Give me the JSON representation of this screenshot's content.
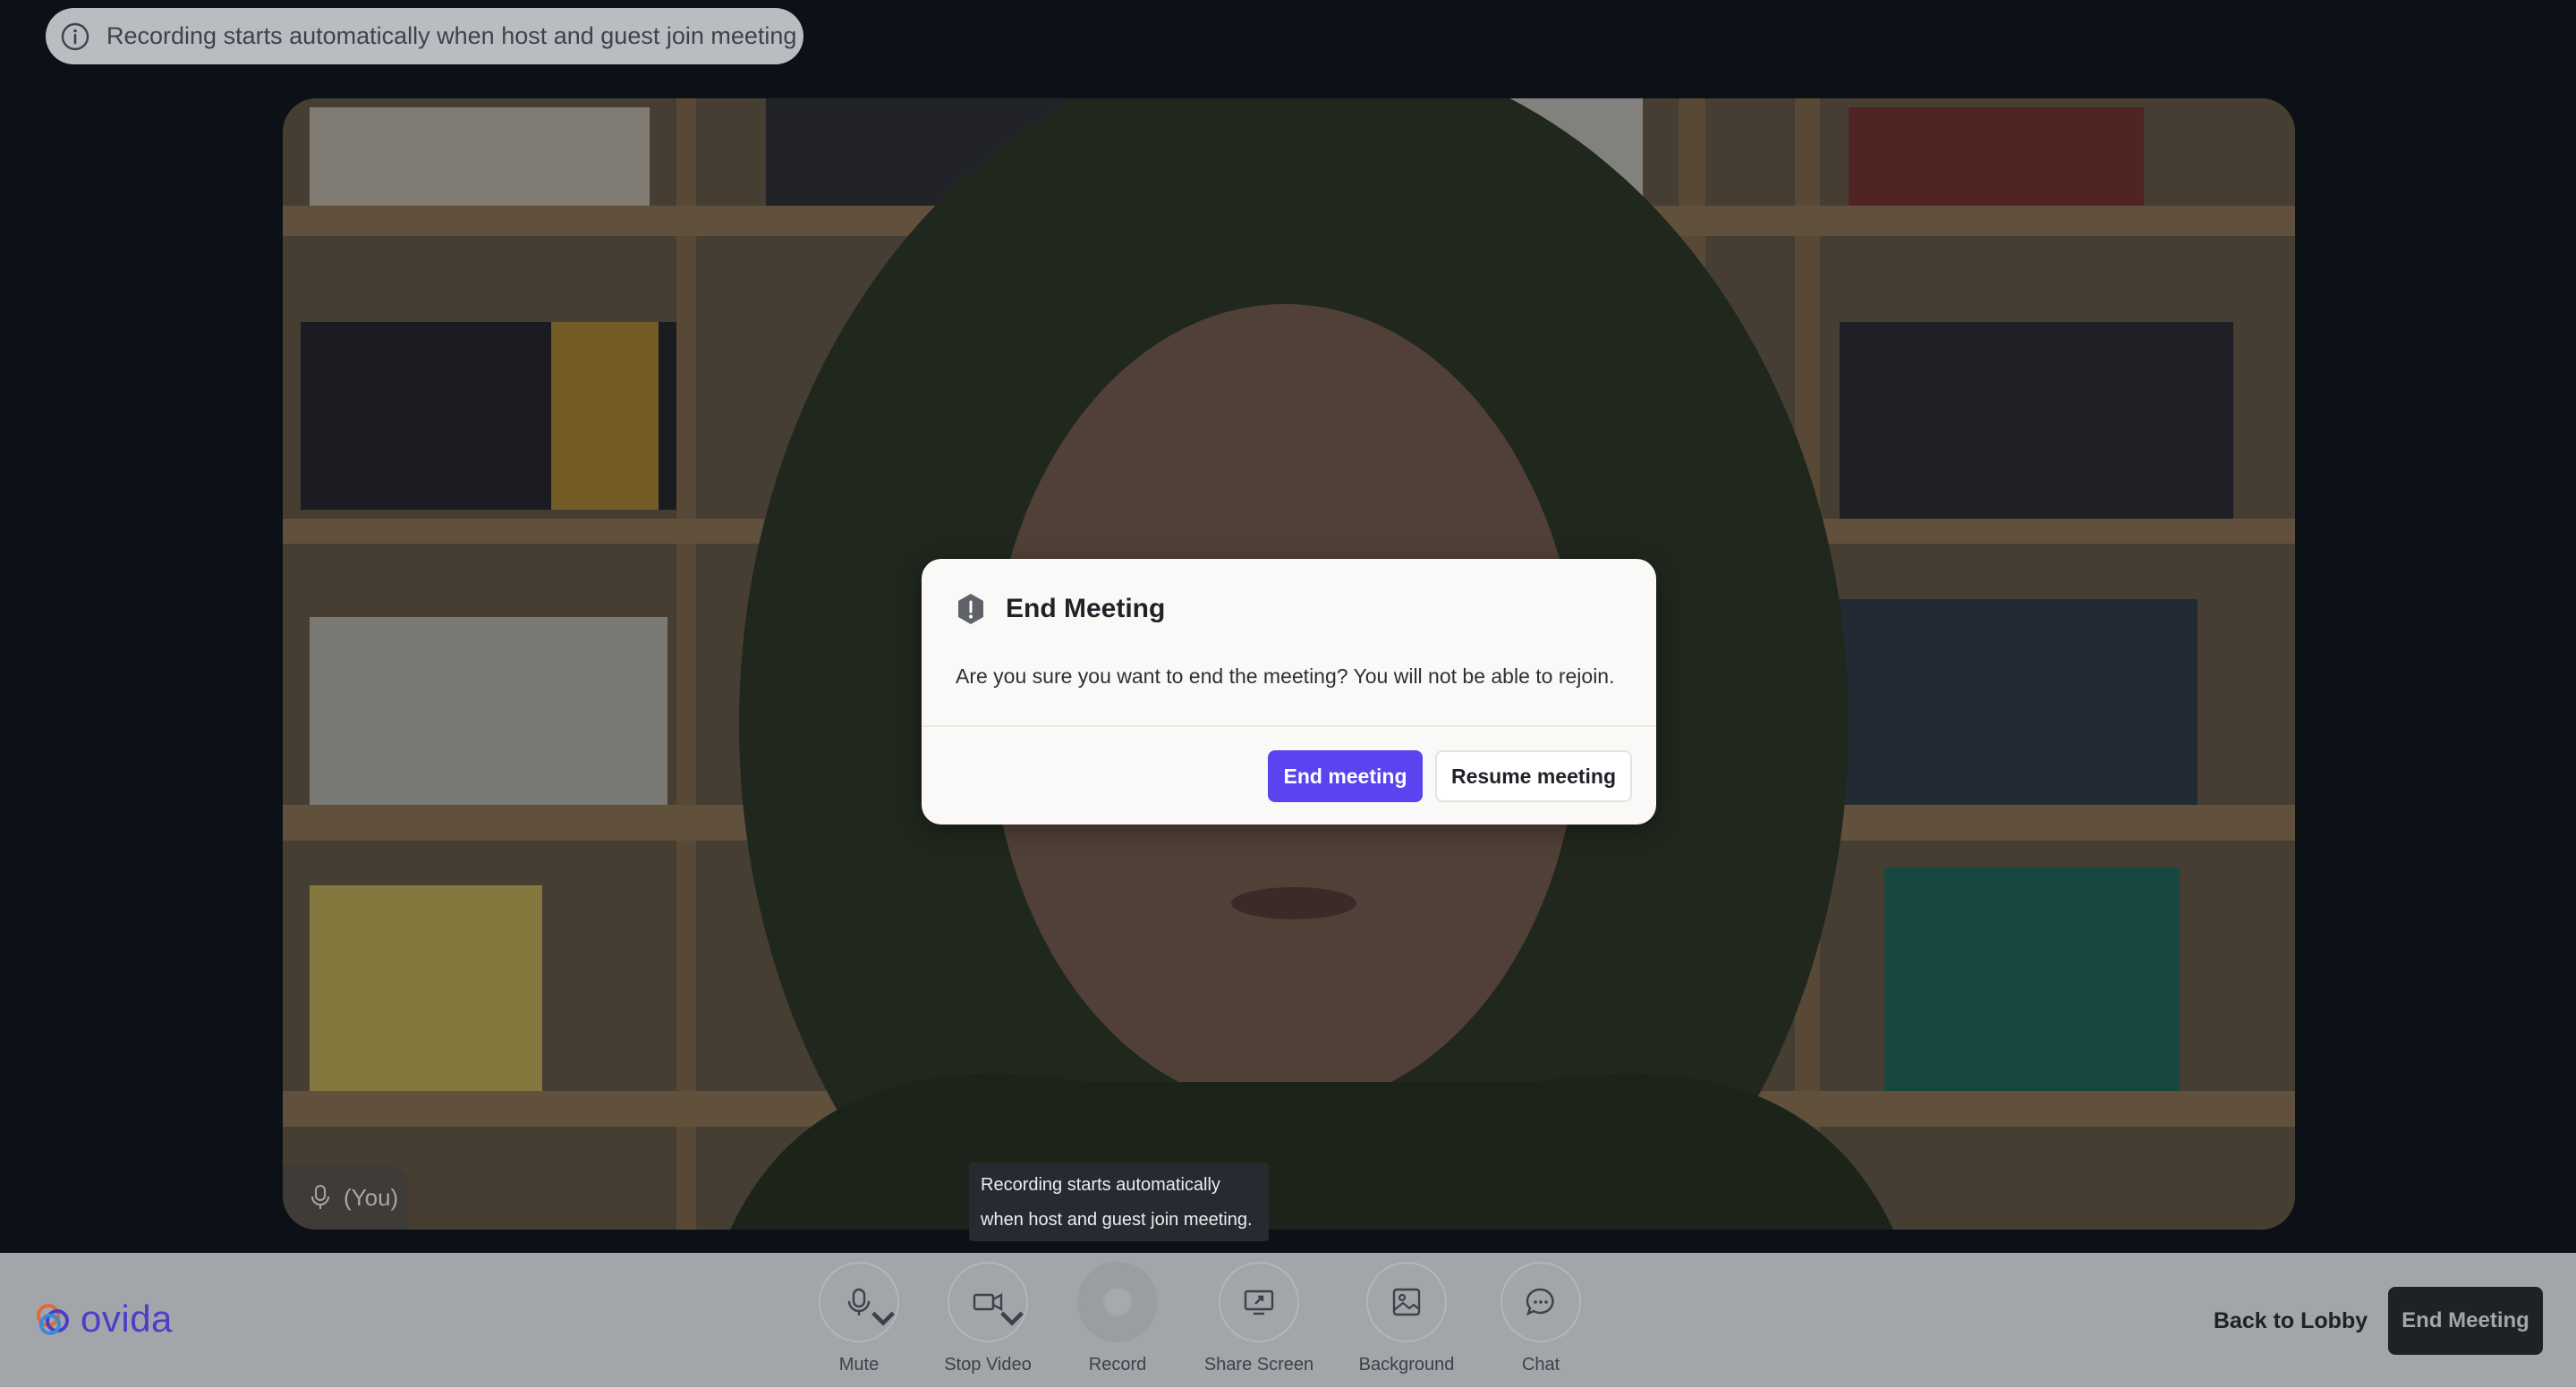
{
  "banner": {
    "info_text": "Recording starts automatically when host and guest join meeting"
  },
  "video": {
    "self_label": "(You)"
  },
  "dialog": {
    "title": "End Meeting",
    "message": "Are you sure you want to end the meeting? You will not be able to rejoin.",
    "confirm_label": "End meeting",
    "cancel_label": "Resume meeting",
    "accent_color": "#5b43f0"
  },
  "tooltip": {
    "line1": "Recording starts automatically",
    "line2": "when host and guest join meeting."
  },
  "brand": {
    "name": "ovida",
    "color": "#4b3ec9"
  },
  "controls": {
    "mute": "Mute",
    "stop_video": "Stop Video",
    "record": "Record",
    "share_screen": "Share Screen",
    "background": "Background",
    "chat": "Chat"
  },
  "actions": {
    "back_to_lobby": "Back to Lobby",
    "end_meeting": "End Meeting"
  }
}
